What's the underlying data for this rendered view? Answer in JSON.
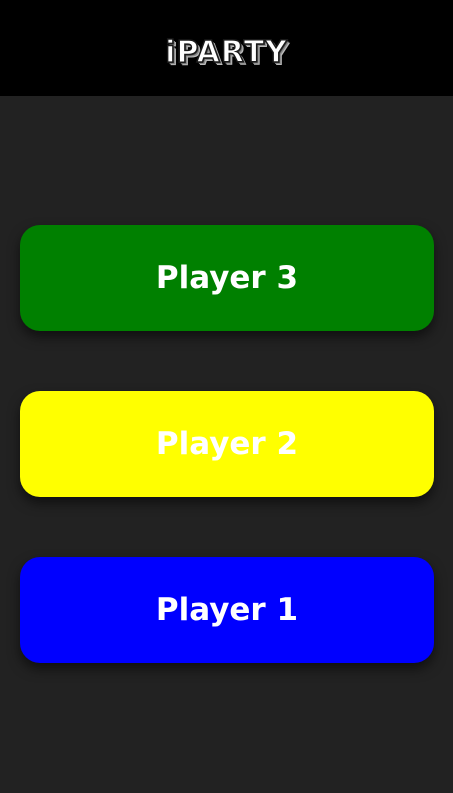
{
  "header": {
    "logo_text": "iPARTY"
  },
  "players": [
    {
      "label": "Player 3",
      "color": "#008000"
    },
    {
      "label": "Player 2",
      "color": "#ffff00"
    },
    {
      "label": "Player 1",
      "color": "#0000ff"
    }
  ],
  "colors": {
    "background": "#222222",
    "header_background": "#000000",
    "button_text": "#ffffff"
  }
}
